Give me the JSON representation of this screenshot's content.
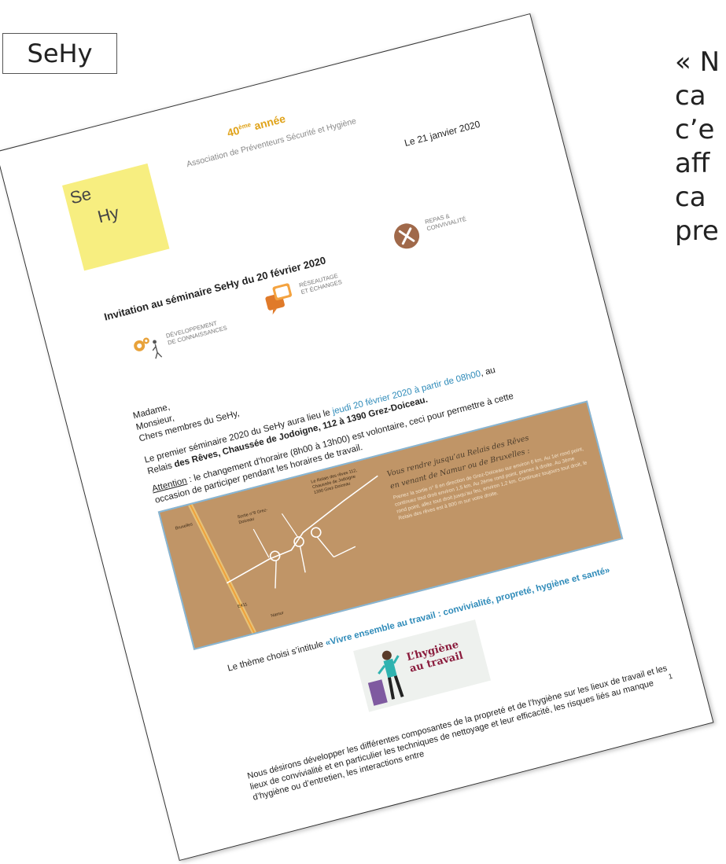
{
  "tag_label": "SeHy",
  "quote_fragment": [
    "« N",
    "ca",
    "c’e",
    "aff",
    "ca",
    "pre"
  ],
  "doc": {
    "logo_line1": "Se",
    "logo_line2": "Hy",
    "year_number": "40",
    "year_sup": "ème",
    "year_word": " année",
    "association": "Association de Préventeurs Sécurité et Hygiène",
    "date": "Le 21 janvier 2020",
    "title": "Invitation au séminaire SeHy du 20 février 2020",
    "services": {
      "dev_line1": "DÉVELOPPEMENT",
      "dev_line2": "DE CONNAISSANCES",
      "net_line1": "RÉSEAUTAGE",
      "net_line2": "ET ÉCHANGES",
      "repas_line1": "REPAS &",
      "repas_line2": "CONVIVIALITÉ"
    },
    "greeting": [
      "Madame,",
      "Monsieur,",
      "Chers membres du SeHy,"
    ],
    "p1_a": "Le premier séminaire 2020 du SeHy aura lieu le ",
    "p1_highlight": "jeudi 20 février 2020 à partir de 08h00",
    "p1_b": ", au",
    "p1_c": "Relais ",
    "p1_bold": "des Rêves, Chaussée de Jodoigne, 112 à 1390 Grez-Doiceau.",
    "p2_label": "Attention",
    "p2_a": " : le changement d’horaire (8h00 à 13h00) est volontaire, ceci pour permettre à cette",
    "p2_b": "occasion de participer pendant les horaires de travail.",
    "map": {
      "heading_1": "Vous rendre jusqu’au Relais des Rêves",
      "heading_2": "en venant de Namur ou de Bruxelles :",
      "directions": "Prenez la sortie n° 8 en direction de Grez-Doiceau sur environ 6 km. Au 1er rond point, continuez tout droit environ 1,5 km. Au 2ème rond point, prenez à droite. Au 3ème rond point, allez tout droit jusqu’au feu, environ 1,2 km. Continuez toujours tout droit, le Relais des rêves est à 800 m sur votre droite.",
      "label_bxl": "Bruxelles",
      "label_exit": "Sortie n°8 Grez-Doiceau",
      "label_relais": "Le Relais des rêves 112, Chaussée de Jodoigne 1390 Grez-Doiceau",
      "label_e411": "E411",
      "label_namur": "Namur"
    },
    "theme_a": "Le thème choisi s’intitule ",
    "theme_b": "«Vivre ensemble au travail : convivialité, propreté, hygiène et santé»",
    "thumb_line1": "L’hygiène",
    "thumb_line2": "au travail",
    "page_number": "1",
    "last_paragraph": "Nous désirons développer les différentes composantes de la propreté et de l’hygiène sur les lieux de travail et les lieux de convivialité et en particulier les techniques de nettoyage et leur efficacité, les risques liés au manque d’hygiène ou d’entretien, les interactions entre"
  }
}
